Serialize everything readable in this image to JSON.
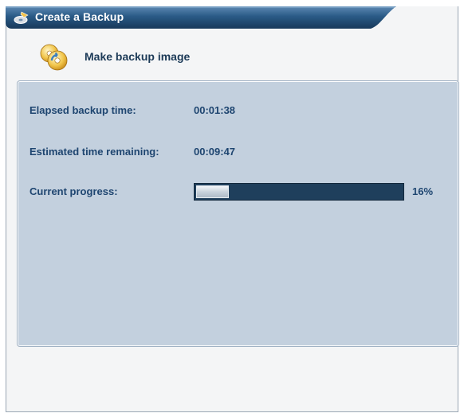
{
  "window": {
    "title": "Create a Backup",
    "title_icon": "backup-wizard-icon"
  },
  "header": {
    "icon": "backup-discs-icon",
    "label": "Make backup image"
  },
  "status": {
    "elapsed_label": "Elapsed backup time:",
    "elapsed_value": "00:01:38",
    "remaining_label": "Estimated time remaining:",
    "remaining_value": "00:09:47",
    "progress_label": "Current progress:",
    "progress_percent_text": "16%",
    "progress_fraction": 0.16
  },
  "colors": {
    "title_bar": "#1f3f5c",
    "panel_bg": "#c3d0de",
    "text": "#1e4570",
    "progress_track": "#1f3f5c"
  }
}
